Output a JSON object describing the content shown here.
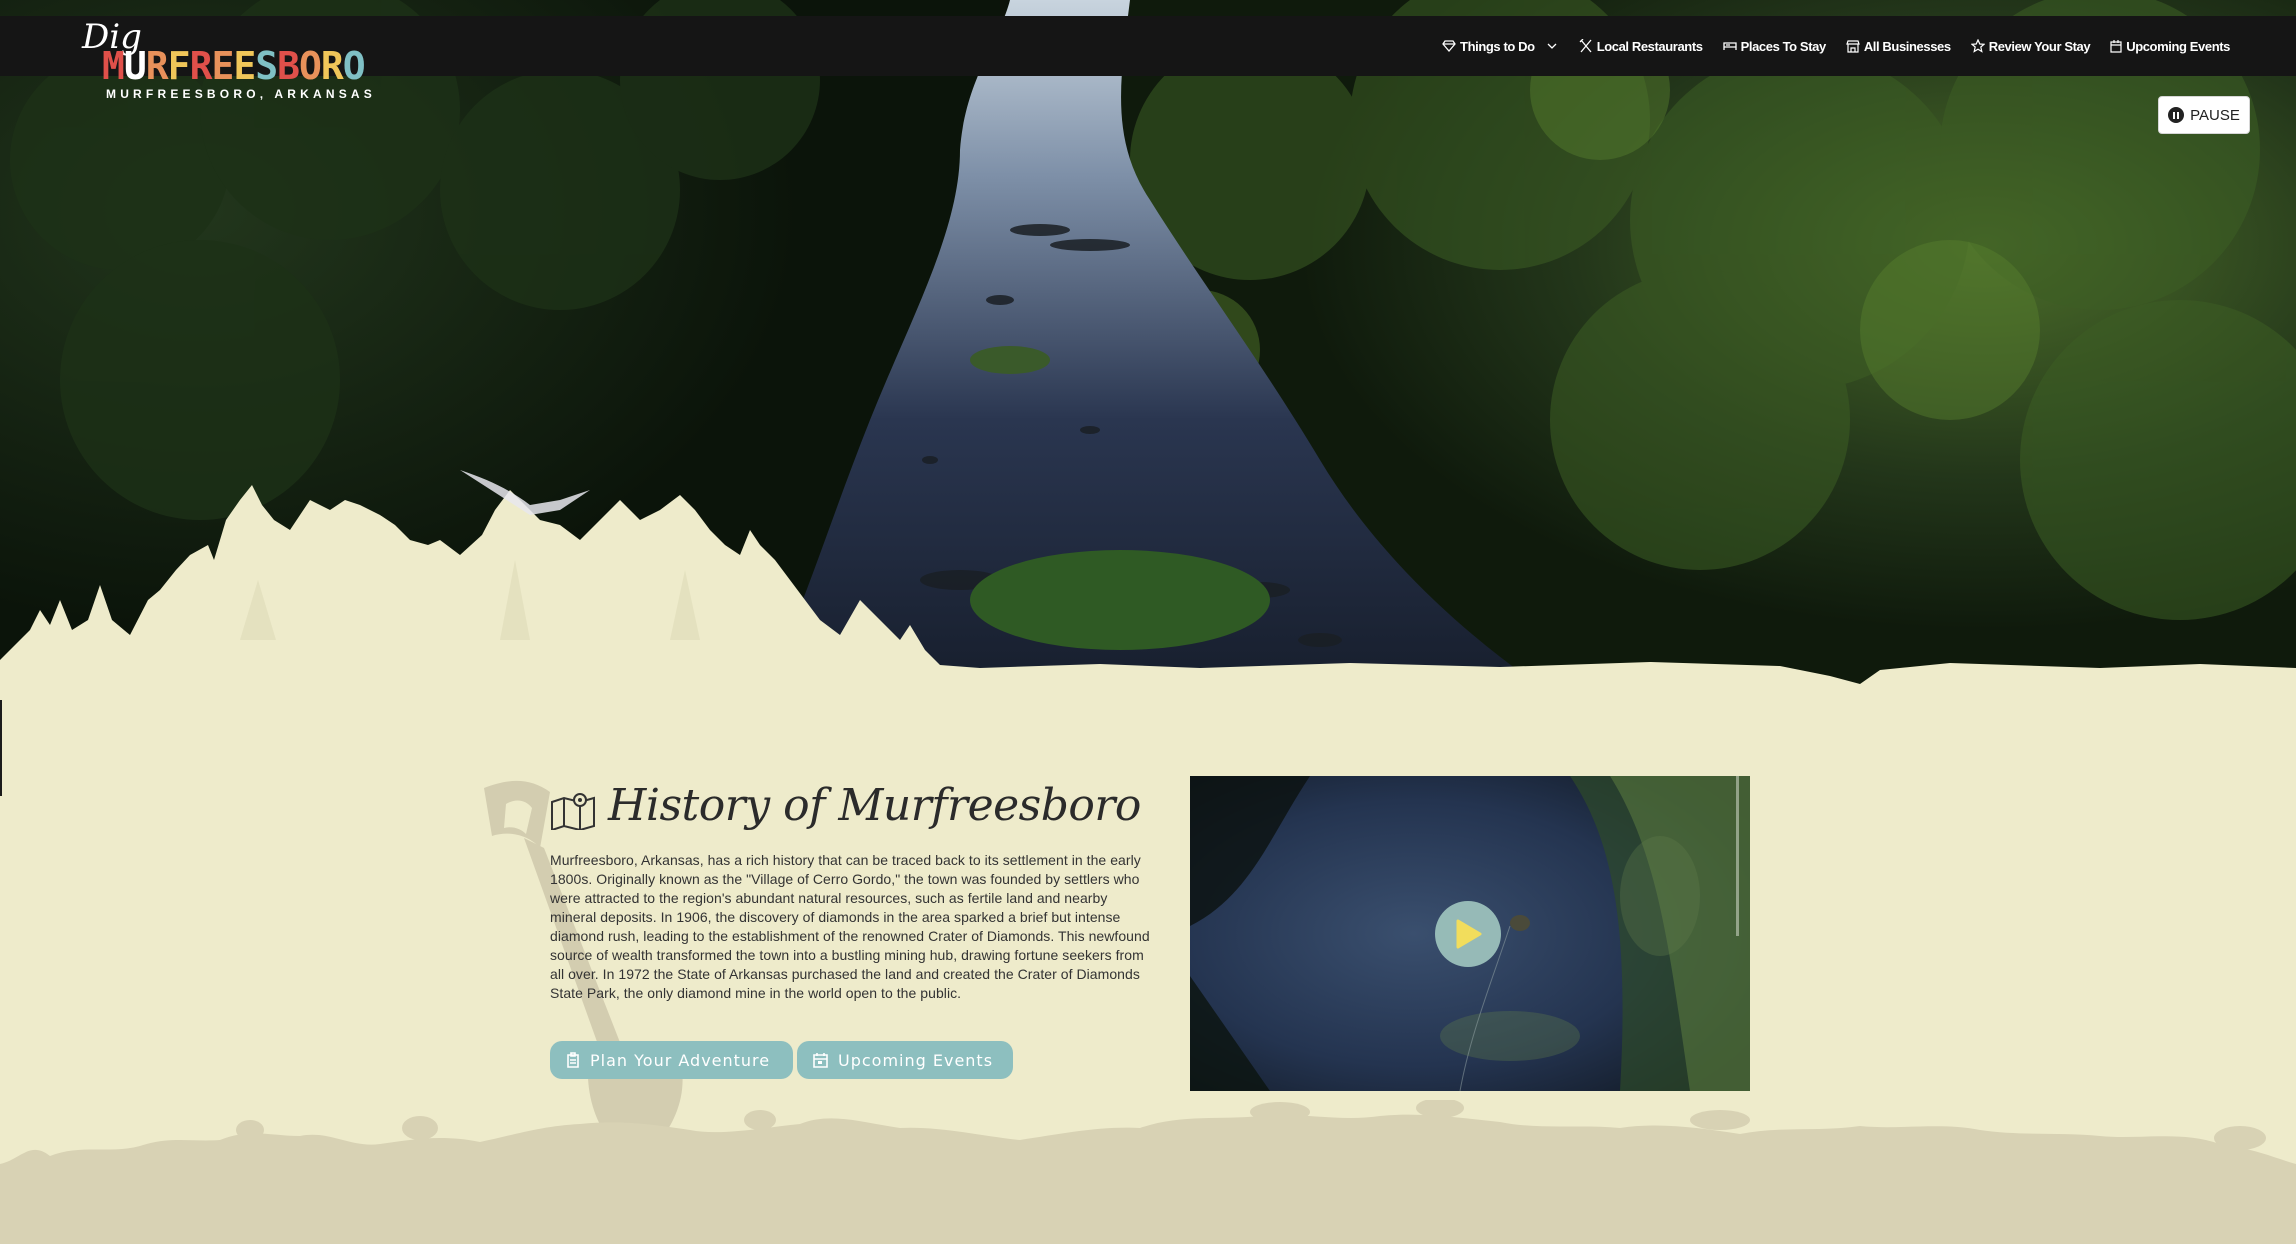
{
  "header": {
    "logo": {
      "script": "Dig",
      "word_letters": [
        {
          "ch": "M",
          "color": "#e0504a"
        },
        {
          "ch": "U",
          "color": "#ffffff"
        },
        {
          "ch": "R",
          "color": "#e8915a"
        },
        {
          "ch": "F",
          "color": "#f0c659"
        },
        {
          "ch": "R",
          "color": "#e0504a"
        },
        {
          "ch": "E",
          "color": "#e8915a"
        },
        {
          "ch": "E",
          "color": "#f0c659"
        },
        {
          "ch": "S",
          "color": "#7fc0c5"
        },
        {
          "ch": "B",
          "color": "#e0504a"
        },
        {
          "ch": "O",
          "color": "#e8915a"
        },
        {
          "ch": "R",
          "color": "#f0c659"
        },
        {
          "ch": "O",
          "color": "#7fc0c5"
        }
      ],
      "subtitle": "MURFREESBORO, ARKANSAS"
    },
    "nav": [
      {
        "label": "Things to Do",
        "icon": "gem-icon",
        "dropdown": true
      },
      {
        "label": "Local Restaurants",
        "icon": "utensils-icon"
      },
      {
        "label": "Places To Stay",
        "icon": "bed-icon"
      },
      {
        "label": "All Businesses",
        "icon": "store-icon"
      },
      {
        "label": "Review Your Stay",
        "icon": "star-icon"
      },
      {
        "label": "Upcoming Events",
        "icon": "calendar-icon"
      }
    ]
  },
  "hero": {
    "pause_label": "PAUSE",
    "pause_icon": "pause-icon"
  },
  "history": {
    "icon": "map-icon",
    "title": "History of Murfreesboro",
    "body": "Murfreesboro, Arkansas, has a rich history that can be traced back to its settlement in the early 1800s. Originally known as the \"Village of Cerro Gordo,\" the town was founded by settlers who were attracted to the region's abundant natural resources, such as fertile land and nearby mineral deposits. In 1906, the discovery of diamonds in the area sparked a brief but intense diamond rush, leading to the establishment of the renowned Crater of Diamonds. This newfound source of wealth transformed the town into a bustling mining hub, drawing fortune seekers from all over. In 1972 the State of Arkansas purchased the land and created the Crater of Diamonds State Park, the only diamond mine in the world open to the public.",
    "buttons": [
      {
        "label": "Plan Your Adventure",
        "icon": "clipboard-icon"
      },
      {
        "label": "Upcoming Events",
        "icon": "calendar-icon"
      }
    ]
  },
  "video": {
    "play_icon": "play-icon"
  },
  "colors": {
    "cream": "#eeebcb",
    "tan": "#d8d2b4",
    "teal_button": "#8dbfbf",
    "header_bg": "#151515",
    "play_yellow": "#f2dd5c"
  }
}
